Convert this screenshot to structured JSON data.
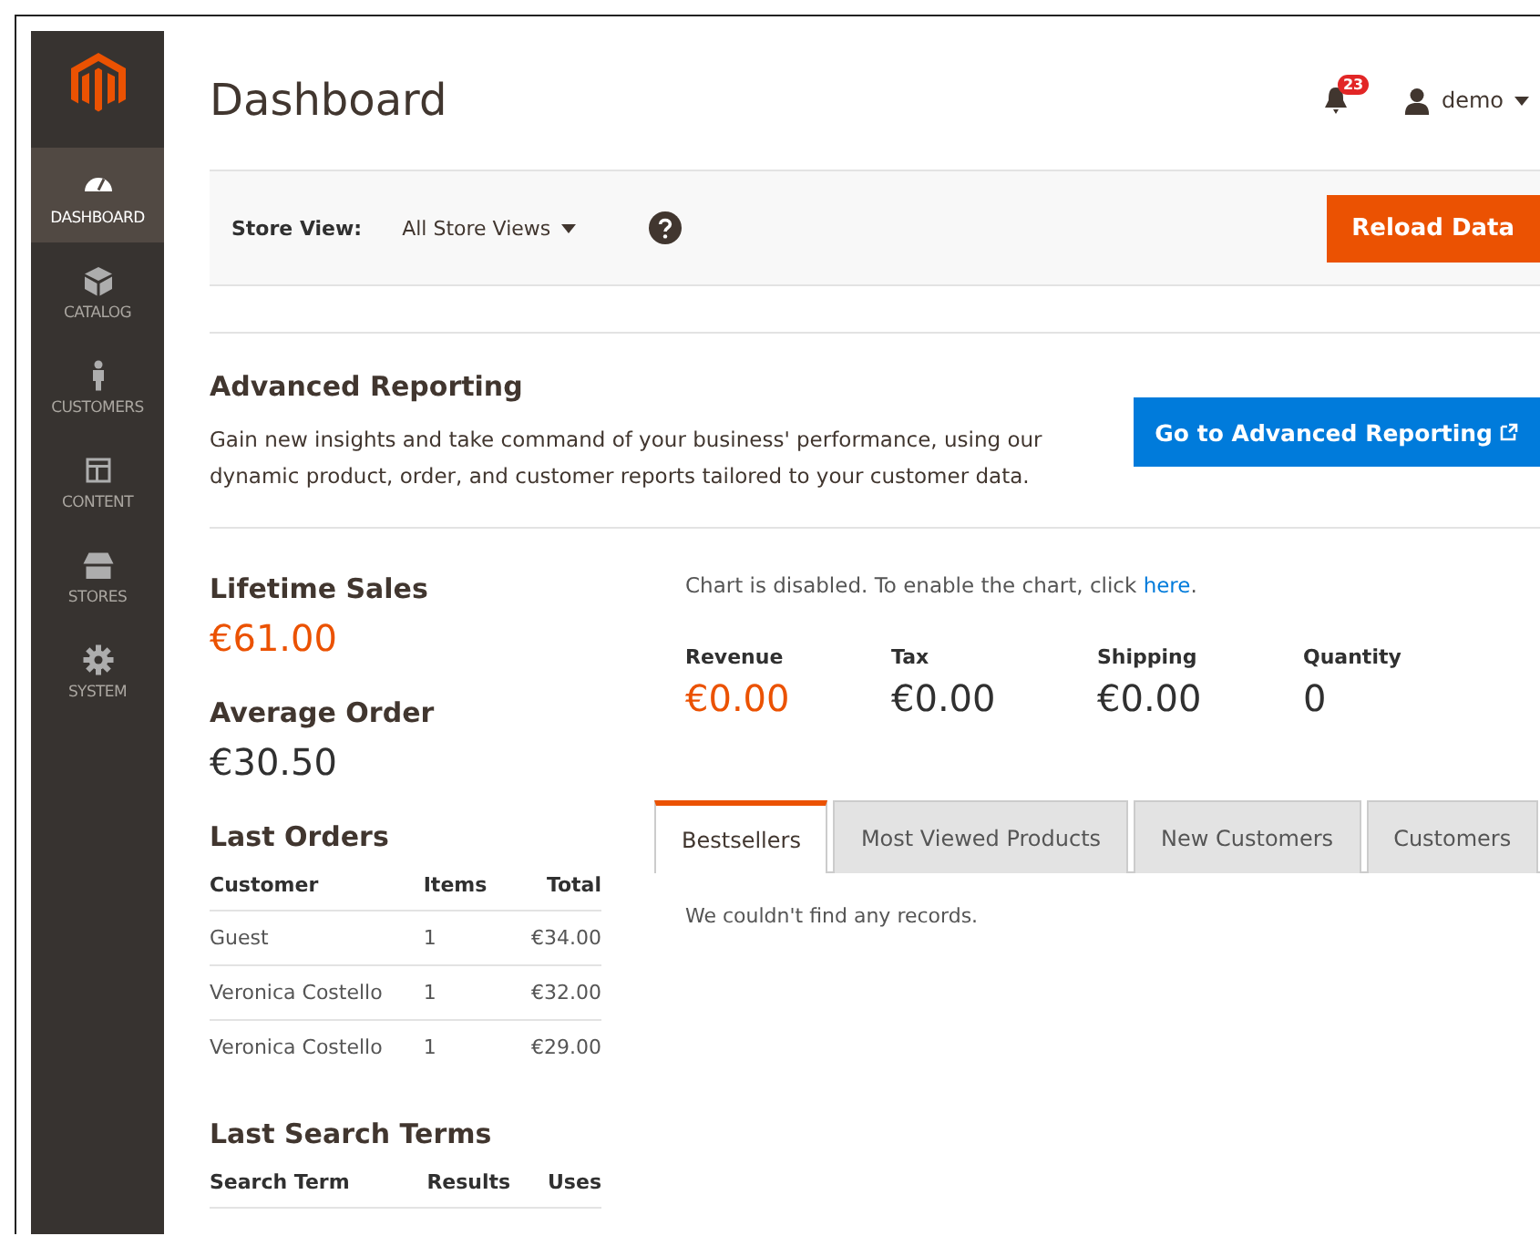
{
  "sidebar": {
    "items": [
      {
        "label": "DASHBOARD",
        "selected": true
      },
      {
        "label": "CATALOG",
        "selected": false
      },
      {
        "label": "CUSTOMERS",
        "selected": false
      },
      {
        "label": "CONTENT",
        "selected": false
      },
      {
        "label": "STORES",
        "selected": false
      },
      {
        "label": "SYSTEM",
        "selected": false
      }
    ]
  },
  "header": {
    "title": "Dashboard",
    "notification_count": "23",
    "user": "demo"
  },
  "store_view": {
    "label": "Store View:",
    "value": "All Store Views",
    "button": "Reload Data"
  },
  "advanced_reporting": {
    "title": "Advanced Reporting",
    "text": "Gain new insights and take command of your business' performance, using our dynamic product, order, and customer reports tailored to your customer data.",
    "button": "Go to Advanced Reporting"
  },
  "lifetime_sales": {
    "label": "Lifetime Sales",
    "value": "€61.00"
  },
  "average_order": {
    "label": "Average Order",
    "value": "€30.50"
  },
  "last_orders": {
    "title": "Last Orders",
    "columns": [
      "Customer",
      "Items",
      "Total"
    ],
    "rows": [
      [
        "Guest",
        "1",
        "€34.00"
      ],
      [
        "Veronica Costello",
        "1",
        "€32.00"
      ],
      [
        "Veronica Costello",
        "1",
        "€29.00"
      ]
    ]
  },
  "last_search_terms": {
    "title": "Last Search Terms",
    "columns": [
      "Search Term",
      "Results",
      "Uses"
    ]
  },
  "chart_notice": {
    "text": "Chart is disabled. To enable the chart, click ",
    "link": "here",
    "end": "."
  },
  "totals": [
    {
      "label": "Revenue",
      "value": "€0.00",
      "highlighted": true
    },
    {
      "label": "Tax",
      "value": "€0.00",
      "highlighted": false
    },
    {
      "label": "Shipping",
      "value": "€0.00",
      "highlighted": false
    },
    {
      "label": "Quantity",
      "value": "0",
      "highlighted": false
    }
  ],
  "tabs": [
    {
      "label": "Bestsellers",
      "selected": true
    },
    {
      "label": "Most Viewed Products",
      "selected": false
    },
    {
      "label": "New Customers",
      "selected": false
    },
    {
      "label": "Customers",
      "selected": false
    }
  ],
  "empty_message": "We couldn't find any records."
}
